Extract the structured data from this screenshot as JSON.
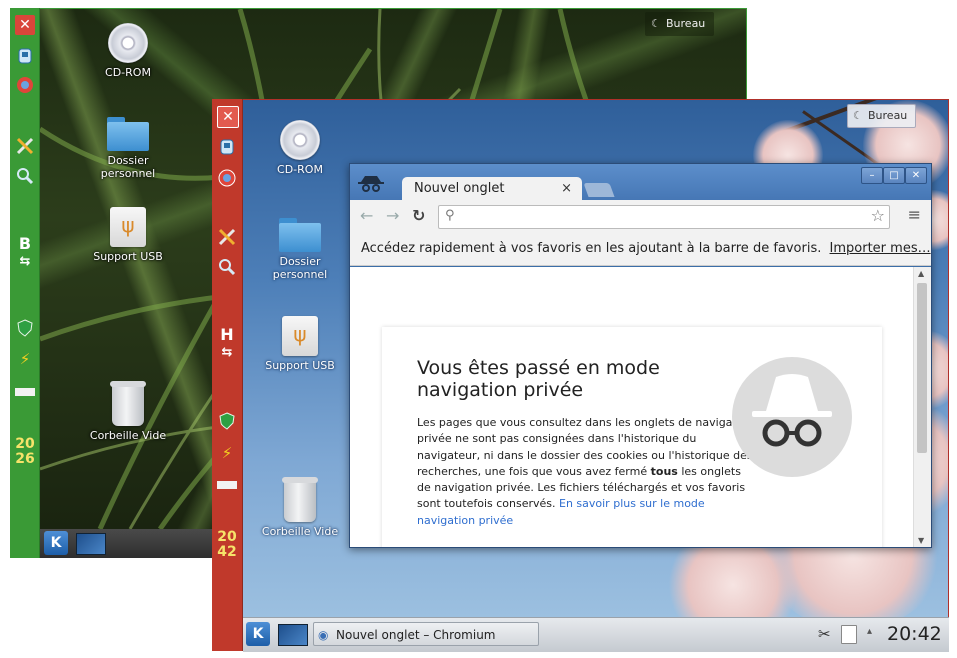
{
  "back_desktop": {
    "panel": {
      "letter": "B",
      "clock_hour": "20",
      "clock_minute": "26"
    },
    "bureau_label": "Bureau",
    "icons": [
      {
        "label": "CD-ROM"
      },
      {
        "label": "Dossier personnel"
      },
      {
        "label": "Support USB"
      },
      {
        "label": "Corbeille Vide"
      }
    ]
  },
  "front_desktop": {
    "panel": {
      "letter": "H",
      "clock_hour": "20",
      "clock_minute": "42"
    },
    "bureau_label": "Bureau",
    "icons": [
      {
        "label": "CD-ROM"
      },
      {
        "label": "Dossier personnel"
      },
      {
        "label": "Support USB"
      },
      {
        "label": "Corbeille Vide"
      }
    ],
    "taskbar": {
      "task_label": "Nouvel onglet – Chromium",
      "clock": "20:42"
    }
  },
  "browser": {
    "tab_title": "Nouvel onglet",
    "tab_close": "×",
    "omnibox_value": "",
    "bookmark_bar_text": "Accédez rapidement à vos favoris en les ajoutant à la barre de favoris.",
    "bookmark_bar_link": "Importer mes…",
    "incognito": {
      "heading": "Vous êtes passé en mode navigation privée",
      "body_before_bold": "Les pages que vous consultez dans les onglets de navigation privée ne sont pas consignées dans l'historique du navigateur, ni dans le dossier des cookies ou l'historique des recherches, une fois que vous avez fermé ",
      "body_bold": "tous",
      "body_after_bold": " les onglets de navigation privée. Les fichiers téléchargés et vos favoris sont toutefois conservés. ",
      "learn_more": "En savoir plus sur le mode navigation privée"
    }
  },
  "colors": {
    "back_panel": "#3a9a36",
    "front_panel": "#c0392b",
    "browser_frame": "#4677b5",
    "link": "#2f6ecf"
  },
  "icons": [
    "close-icon",
    "network-icon",
    "browser-icon",
    "tools-icon",
    "search-icon",
    "shield-icon",
    "power-icon",
    "battery-icon",
    "cdrom-icon",
    "home-folder-icon",
    "usb-icon",
    "trash-icon",
    "kde-menu-icon",
    "screen-icon",
    "scissors-icon",
    "clipboard-icon",
    "incognito-icon",
    "star-icon",
    "menu-icon",
    "reload-icon",
    "back-icon",
    "forward-icon"
  ]
}
